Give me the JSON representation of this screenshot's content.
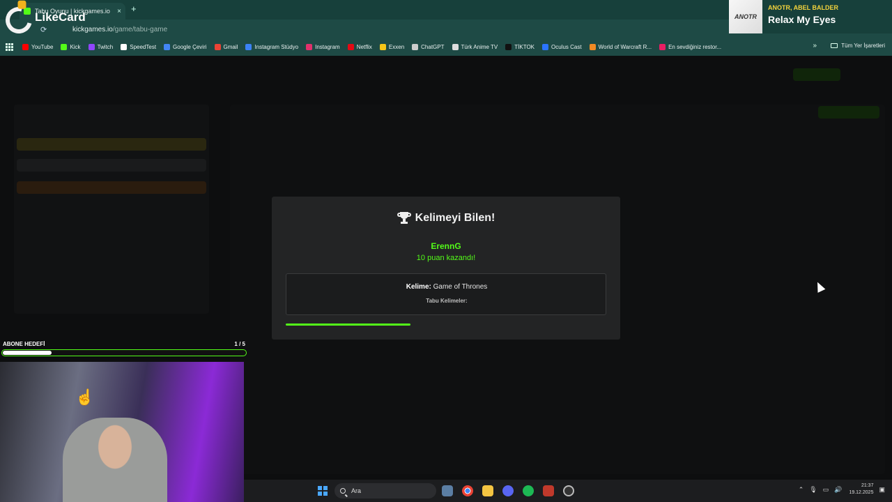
{
  "browser": {
    "tab_title": "Tabu Oyunu | kickgames.io",
    "tab_close": "×",
    "new_tab": "+",
    "url_host": "kickgames.io",
    "url_path": "/game/tabu-game",
    "bookmarks": [
      {
        "label": "YouTube",
        "color": "#ff0000"
      },
      {
        "label": "Kick",
        "color": "#53fc18"
      },
      {
        "label": "Twitch",
        "color": "#9146ff"
      },
      {
        "label": "SpeedTest",
        "color": "#ffffff"
      },
      {
        "label": "Google Çeviri",
        "color": "#4285f4"
      },
      {
        "label": "Gmail",
        "color": "#ea4335"
      },
      {
        "label": "Instagram Stüdyo",
        "color": "#3b82f6"
      },
      {
        "label": "Instagram",
        "color": "#e1306c"
      },
      {
        "label": "Netflix",
        "color": "#e50914"
      },
      {
        "label": "Exxen",
        "color": "#f5c518"
      },
      {
        "label": "ChatGPT",
        "color": "#cccccc"
      },
      {
        "label": "Türk Anime TV",
        "color": "#dddddd"
      },
      {
        "label": "TİKTOK",
        "color": "#111111"
      },
      {
        "label": "Oculus Cast",
        "color": "#2b74ff"
      },
      {
        "label": "World of Warcraft R...",
        "color": "#f08a24"
      },
      {
        "label": "En sevdiğiniz restor...",
        "color": "#e91e63"
      }
    ],
    "bookmarks_more": "»",
    "all_bookmarks": "Tüm Yer İşaretleri"
  },
  "overlay": {
    "likecard": "LikeCard",
    "now_playing": {
      "cover_text": "ANOTR",
      "artist": "ANOTR, ABEL BALDER",
      "title": "Relax My Eyes"
    }
  },
  "modal": {
    "title": "Kelimeyi Bilen!",
    "winner": "ErennG",
    "points": "10 puan kazandı!",
    "word_label": "Kelime:",
    "word_value": " Game of Thrones",
    "taboo_label": "Tabu Kelimeler:",
    "progress": 0.39,
    "accent": "#53fc18"
  },
  "sub_goal": {
    "label": "ABONE HEDEFİ",
    "count": "1 / 5",
    "progress": 0.2
  },
  "taskbar": {
    "search_placeholder": "Ara",
    "time": "21:37",
    "date": "19.12.2025"
  }
}
